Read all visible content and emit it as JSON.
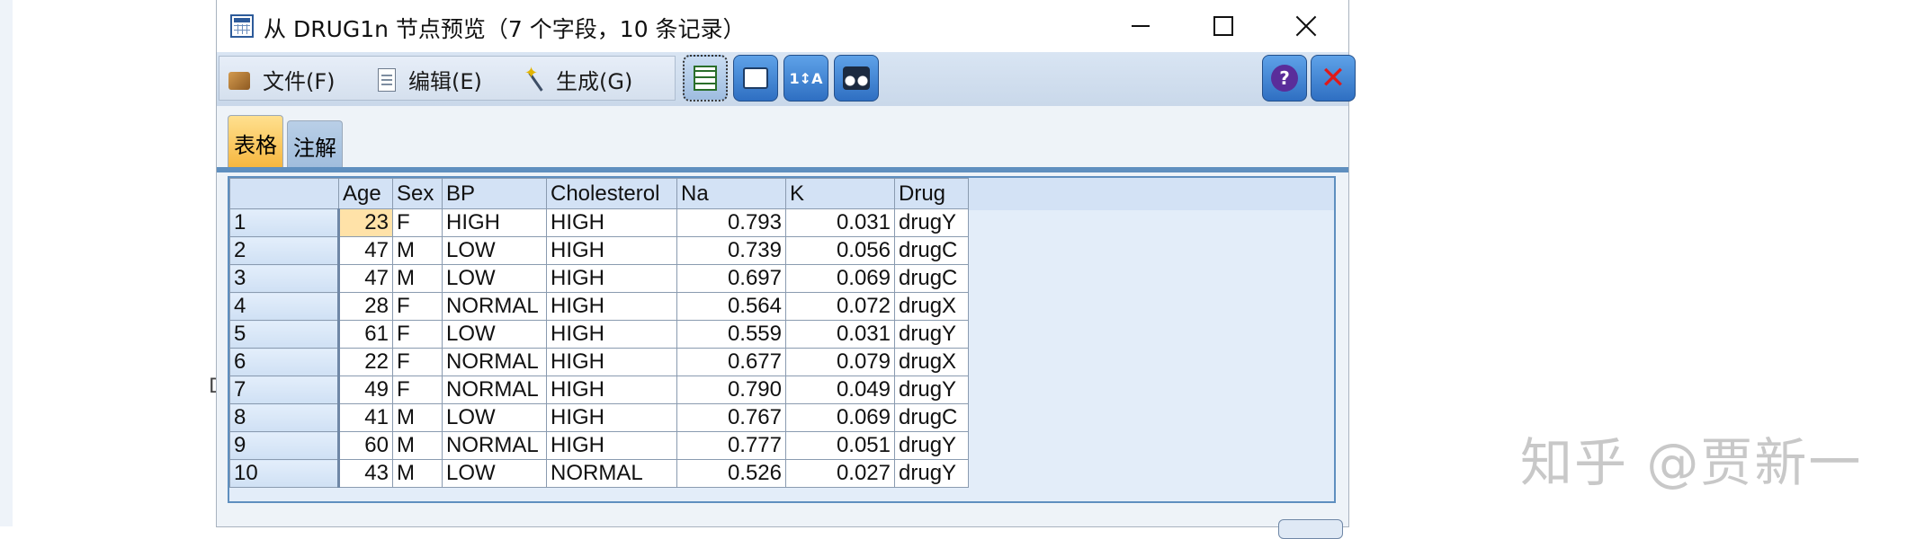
{
  "window": {
    "title": "从 DRUG1n 节点预览（7 个字段，10 条记录）",
    "icon": "table-window-icon"
  },
  "menu": {
    "file": "文件(F)",
    "edit": "编辑(E)",
    "generate": "生成(G)"
  },
  "toolbar": {
    "icons": [
      "table-view-icon",
      "print-icon",
      "sort-icon",
      "find-icon",
      "help-icon",
      "close-red-icon"
    ]
  },
  "tabs": {
    "table": "表格",
    "notes": "注解",
    "active": "表格"
  },
  "grid": {
    "columns": [
      "",
      "Age",
      "Sex",
      "BP",
      "Cholesterol",
      "Na",
      "K",
      "Drug"
    ],
    "rows": [
      [
        "1",
        "23",
        "F",
        "HIGH",
        "HIGH",
        "0.793",
        "0.031",
        "drugY"
      ],
      [
        "2",
        "47",
        "M",
        "LOW",
        "HIGH",
        "0.739",
        "0.056",
        "drugC"
      ],
      [
        "3",
        "47",
        "M",
        "LOW",
        "HIGH",
        "0.697",
        "0.069",
        "drugC"
      ],
      [
        "4",
        "28",
        "F",
        "NORMAL",
        "HIGH",
        "0.564",
        "0.072",
        "drugX"
      ],
      [
        "5",
        "61",
        "F",
        "LOW",
        "HIGH",
        "0.559",
        "0.031",
        "drugY"
      ],
      [
        "6",
        "22",
        "F",
        "NORMAL",
        "HIGH",
        "0.677",
        "0.079",
        "drugX"
      ],
      [
        "7",
        "49",
        "F",
        "NORMAL",
        "HIGH",
        "0.790",
        "0.049",
        "drugY"
      ],
      [
        "8",
        "41",
        "M",
        "LOW",
        "HIGH",
        "0.767",
        "0.069",
        "drugC"
      ],
      [
        "9",
        "60",
        "M",
        "NORMAL",
        "HIGH",
        "0.777",
        "0.051",
        "drugY"
      ],
      [
        "10",
        "43",
        "M",
        "LOW",
        "NORMAL",
        "0.526",
        "0.027",
        "drugY"
      ]
    ],
    "selected_cell_color": "#ffe2a8"
  },
  "background": {
    "fragment": "D",
    "watermark": "知乎 @贾新一"
  },
  "colors": {
    "accent": "#5f8fbf",
    "active_tab": "#f6b43a",
    "close_red": "#e01a1a"
  }
}
